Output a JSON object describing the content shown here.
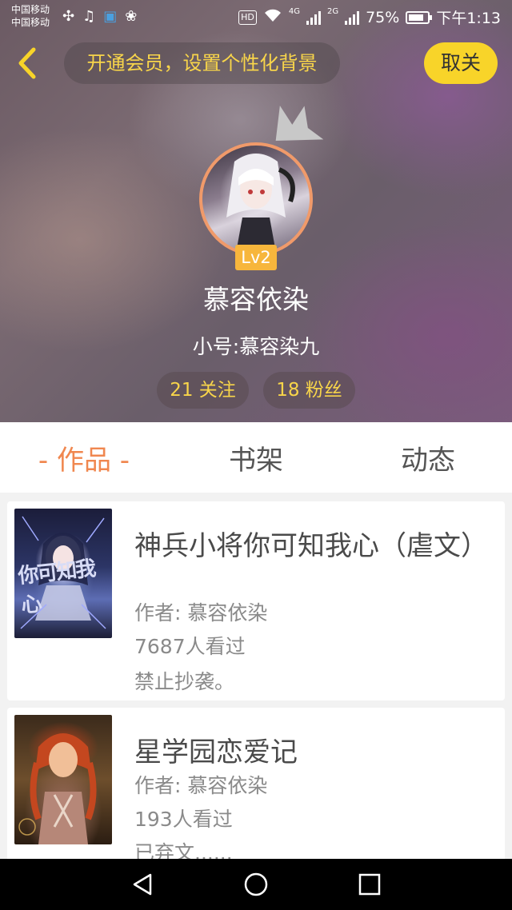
{
  "status_bar": {
    "carrier_1": "中国移动",
    "carrier_2": "中国移动",
    "hd": "HD",
    "net_1": "4G",
    "net_2": "2G",
    "battery": "75%",
    "time": "下午1:13"
  },
  "header": {
    "vip_prompt": "开通会员，设置个性化背景",
    "unfollow_button": "取关"
  },
  "profile": {
    "level": "Lv2",
    "username": "慕容依染",
    "alt_account": "小号:慕容染九",
    "following": "21 关注",
    "followers": "18 粉丝"
  },
  "tabs": [
    {
      "label": "- 作品 -",
      "active": true
    },
    {
      "label": "书架",
      "active": false
    },
    {
      "label": "动态",
      "active": false
    }
  ],
  "books": [
    {
      "title": "神兵小将你可知我心（虐文）",
      "cover_text": "你可知我心",
      "author": "作者: 慕容依染",
      "views": "7687人看过",
      "note": "禁止抄袭。"
    },
    {
      "title": "星学园恋爱记",
      "author": "作者: 慕容依染",
      "views": "193人看过",
      "note": "已弃文......"
    }
  ],
  "colors": {
    "accent_orange": "#f0874f",
    "vip_yellow": "#f8d54a",
    "button_yellow": "#f8d429",
    "level_badge": "#f7b63c"
  },
  "icons": {
    "back": "chevron-left-icon",
    "crown": "crown-icon",
    "nav_back": "triangle-back-icon",
    "nav_home": "circle-home-icon",
    "nav_recent": "square-recent-icon"
  }
}
